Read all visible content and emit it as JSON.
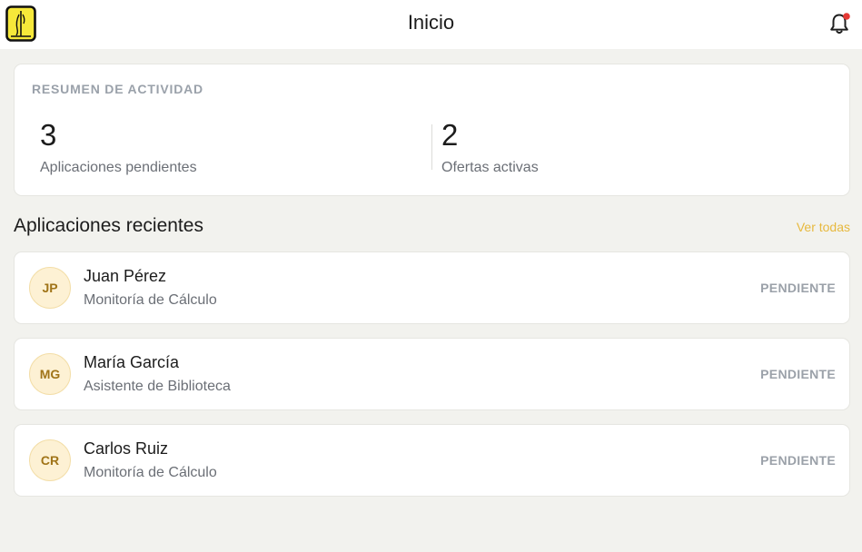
{
  "header": {
    "title": "Inicio",
    "logo_icon": "university-crest-icon",
    "notification_icon": "bell-icon",
    "notification_badge_color": "#e53935"
  },
  "summary": {
    "label": "RESUMEN DE ACTIVIDAD",
    "stats": [
      {
        "value": "3",
        "label": "Aplicaciones pendientes"
      },
      {
        "value": "2",
        "label": "Ofertas activas"
      }
    ]
  },
  "recent": {
    "title": "Aplicaciones recientes",
    "see_all_label": "Ver todas",
    "accent_color": "#e7b93e",
    "items": [
      {
        "initials": "JP",
        "name": "Juan Pérez",
        "role": "Monitoría de Cálculo",
        "status": "PENDIENTE"
      },
      {
        "initials": "MG",
        "name": "María García",
        "role": "Asistente de Biblioteca",
        "status": "PENDIENTE"
      },
      {
        "initials": "CR",
        "name": "Carlos Ruiz",
        "role": "Monitoría de Cálculo",
        "status": "PENDIENTE"
      }
    ]
  }
}
